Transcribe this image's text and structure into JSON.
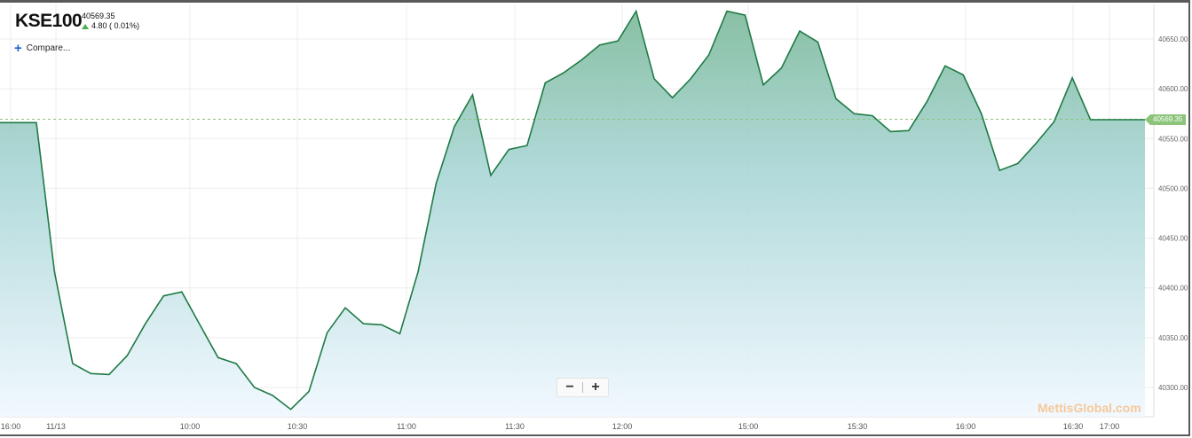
{
  "header": {
    "symbol": "KSE100",
    "last_value": "40569.35",
    "change": "4.80 ( 0.01%)",
    "compare_label": "Compare..."
  },
  "zoom": {
    "minus": "−",
    "plus": "+"
  },
  "watermark": "MettisGlobal.com",
  "last_price_label": "40569.35",
  "colors": {
    "line": "#1e7a45",
    "accent_label": "#8cc47a",
    "up": "#4caf50",
    "compare": "#1e63c9"
  },
  "chart_data": {
    "type": "area",
    "x_tick_labels": [
      "16:00",
      "11/13",
      "10:00",
      "10:30",
      "11:00",
      "11:30",
      "12:00",
      "15:00",
      "15:30",
      "16:00",
      "16:30",
      "17:00"
    ],
    "y_tick_labels": [
      "40650.00",
      "40600.00",
      "40550.00",
      "40500.00",
      "40450.00",
      "40400.00",
      "40350.00",
      "40300.00"
    ],
    "ylim": [
      40280,
      40680
    ],
    "grid": true,
    "last_value_line": 40569.35,
    "values": [
      40566,
      40566,
      40566,
      40416,
      40324,
      40314,
      40313,
      40332,
      40364,
      40392,
      40396,
      40363,
      40330,
      40324,
      40300,
      40292,
      40278,
      40296,
      40355,
      40380,
      40364,
      40363,
      40354,
      40416,
      40505,
      40562,
      40594,
      40513,
      40539,
      40543,
      40606,
      40616,
      40629,
      40644,
      40648,
      40678,
      40610,
      40591,
      40610,
      40634,
      40678,
      40674,
      40604,
      40621,
      40658,
      40647,
      40590,
      40575,
      40573,
      40557,
      40558,
      40587,
      40623,
      40614,
      40575,
      40518,
      40525,
      40545,
      40567,
      40611,
      40569,
      40569,
      40569,
      40569
    ]
  }
}
